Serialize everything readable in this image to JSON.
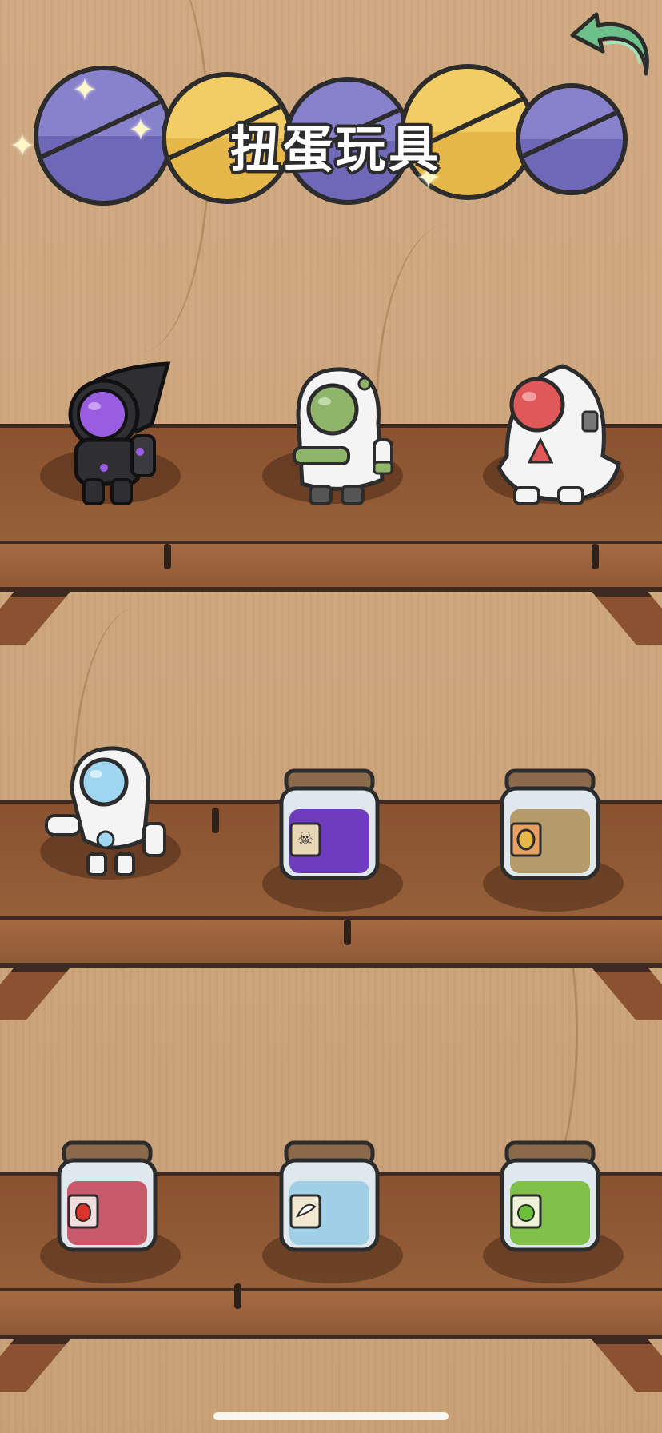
{
  "header": {
    "title": "扭蛋玩具",
    "back_icon": "curved-arrow-back-icon"
  },
  "colors": {
    "back_arrow": "#6dc08a",
    "capsule_purple": "#6f68b8",
    "capsule_yellow": "#e6b84a",
    "shelf_wood": "#8a5230"
  },
  "shelves": [
    {
      "items": [
        {
          "kind": "astronaut",
          "icon": "black-astronaut-figure-icon",
          "visor": "#9b5de0",
          "suit": "#2e2e33"
        },
        {
          "kind": "astronaut",
          "icon": "white-astronaut-figure-icon",
          "visor": "#8fb56a",
          "suit": "#f4f4f4"
        },
        {
          "kind": "astronaut",
          "icon": "white-astronaut-figure-icon",
          "visor": "#e05858",
          "suit": "#f4f4f4"
        }
      ]
    },
    {
      "items": [
        {
          "kind": "astronaut",
          "icon": "robot-astronaut-figure-icon",
          "visor": "#9fd7f2",
          "suit": "#f4f4f4"
        },
        {
          "kind": "jar",
          "icon": "potion-jar-icon",
          "fill": "#6f3cbf",
          "label_icon": "skull-label-icon"
        },
        {
          "kind": "jar",
          "icon": "seed-jar-icon",
          "fill": "#b59a6a",
          "label_icon": "seed-label-icon"
        }
      ]
    },
    {
      "items": [
        {
          "kind": "jar",
          "icon": "strawberry-jar-icon",
          "fill": "#c95a6c",
          "label_icon": "strawberry-label-icon"
        },
        {
          "kind": "jar",
          "icon": "water-jar-icon",
          "fill": "#9fd0e6",
          "label_icon": "wing-label-icon"
        },
        {
          "kind": "jar",
          "icon": "apple-jar-icon",
          "fill": "#7fbf4a",
          "label_icon": "apple-label-icon"
        }
      ]
    }
  ]
}
